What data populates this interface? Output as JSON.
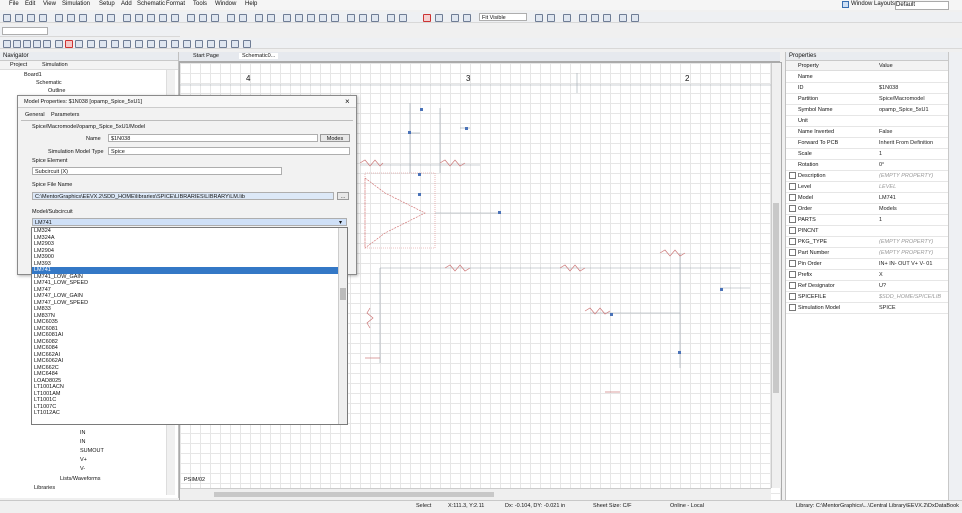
{
  "menu": {
    "file": "File",
    "edit": "Edit",
    "view": "View",
    "simulation": "Simulation",
    "setup": "Setup",
    "add": "Add",
    "schematic": "Schematic",
    "format": "Format",
    "tools": "Tools",
    "window": "Window",
    "help": "Help"
  },
  "top_right": {
    "layout_label": "Window Layouts:",
    "layout_value": "Default"
  },
  "toolbar": {
    "zoom_value": "Fit Visible"
  },
  "navigator": {
    "title": "Navigator",
    "tabs": [
      "Project",
      "Simulation"
    ],
    "items": [
      "Board1",
      "Schematic",
      "Outline"
    ],
    "lower_items": [
      "LINE2",
      "IN",
      "IN",
      "SUMOUT",
      "V+",
      "V-",
      "Lists/Waveforms",
      "Libraries"
    ]
  },
  "doc_tabs": [
    "Start Page",
    "Schematic0..."
  ],
  "canvas": {
    "zone_numbers": [
      "4",
      "3",
      "2"
    ],
    "footer_label": "PSIM/02"
  },
  "dialog": {
    "title": "Model Properties: $1N038 [opamp_Spice_5xU1]",
    "tabs": [
      "General",
      "Parameters"
    ],
    "group_title": "Spice/Macromodel/opamp_Spice_5xU1/Model",
    "name_label": "Name",
    "name_value": "$1N038",
    "more_button": "Modes",
    "model_type_label": "Simulation Model Type",
    "model_type_value": "Spice",
    "spice_element_label": "Spice Element",
    "spice_element_value": "Subcircuit (X)",
    "spice_file_label": "Spice File Name",
    "spice_file_value": "C:\\MentorGraphics\\EEVX.2\\SDD_HOME\\libraries\\SPICE\\LIBRARIES\\LIBRARY\\LM.lib",
    "browse_button": "...",
    "model_select_label": "Model/Subcircuit",
    "model_select_value": "LM741",
    "models": [
      "LM324",
      "LM324A",
      "LM2903",
      "LM2904",
      "LM3900",
      "LM393",
      "LM741",
      "LM741_LOW_GAIN",
      "LM741_LOW_SPEED",
      "LM747",
      "LM747_LOW_GAIN",
      "LM747_LOW_SPEED",
      "LM833",
      "LM837N",
      "LMC6035",
      "LMC6081",
      "LMC6081AI",
      "LMC6082",
      "LMC6084",
      "LMC662AI",
      "LMC6062AI",
      "LMC662C",
      "LMC6484",
      "LOAD8025",
      "LT1001ACN",
      "LT1001AM",
      "LT1001C",
      "LT1007C",
      "LT1012AC"
    ],
    "selected_index": 6
  },
  "properties": {
    "title": "Properties",
    "col_property": "Property",
    "col_value": "Value",
    "rows": [
      {
        "k": "Name",
        "v": "",
        "cb": false,
        "g": false
      },
      {
        "k": "ID",
        "v": "$1N038",
        "cb": false,
        "g": false
      },
      {
        "k": "Partition",
        "v": "Spice/Macromodel",
        "cb": false,
        "g": false
      },
      {
        "k": "Symbol Name",
        "v": "opamp_Spice_5xU1",
        "cb": false,
        "g": false
      },
      {
        "k": "Unit",
        "v": "",
        "cb": false,
        "g": false
      },
      {
        "k": "Name Inverted",
        "v": "False",
        "cb": false,
        "g": false
      },
      {
        "k": "Forward To PCB",
        "v": "Inherit From Definition",
        "cb": false,
        "g": false
      },
      {
        "k": "Scale",
        "v": "1",
        "cb": false,
        "g": false
      },
      {
        "k": "Rotation",
        "v": "0°",
        "cb": false,
        "g": false
      },
      {
        "k": "Description",
        "v": "(EMPTY PROPERTY)",
        "cb": true,
        "g": true
      },
      {
        "k": "Level",
        "v": "LEVEL",
        "cb": true,
        "g": true
      },
      {
        "k": "Model",
        "v": "LM741",
        "cb": true,
        "g": false
      },
      {
        "k": "Order",
        "v": "Models",
        "cb": true,
        "g": false
      },
      {
        "k": "PARTS",
        "v": "1",
        "cb": true,
        "g": false
      },
      {
        "k": "PINCNT",
        "v": "",
        "cb": true,
        "g": false
      },
      {
        "k": "PKG_TYPE",
        "v": "(EMPTY PROPERTY)",
        "cb": true,
        "g": true
      },
      {
        "k": "Part Number",
        "v": "(EMPTY PROPERTY)",
        "cb": true,
        "g": true
      },
      {
        "k": "Pin Order",
        "v": "IN+ IN- OUT V+ V- 01",
        "cb": true,
        "g": false
      },
      {
        "k": "Prefix",
        "v": "X",
        "cb": true,
        "g": false
      },
      {
        "k": "Ref Designator",
        "v": "U?",
        "cb": true,
        "g": false
      },
      {
        "k": "SPICEFILE",
        "v": "$SDD_HOME/SPICE/LIB",
        "cb": true,
        "g": true
      },
      {
        "k": "Simulation Model",
        "v": "SPICE",
        "cb": true,
        "g": false
      }
    ]
  },
  "status": {
    "select": "Select",
    "coords": "X:111.3, Y:2.11",
    "dx": "Dx: -0.104, DY: -0.021 in",
    "sheet": "Sheet Size: C/F",
    "online": "Online - Local",
    "library": "Library: C:\\MentorGraphics\\...\\Central Library\\EEVX.2\\DxDataBook"
  }
}
